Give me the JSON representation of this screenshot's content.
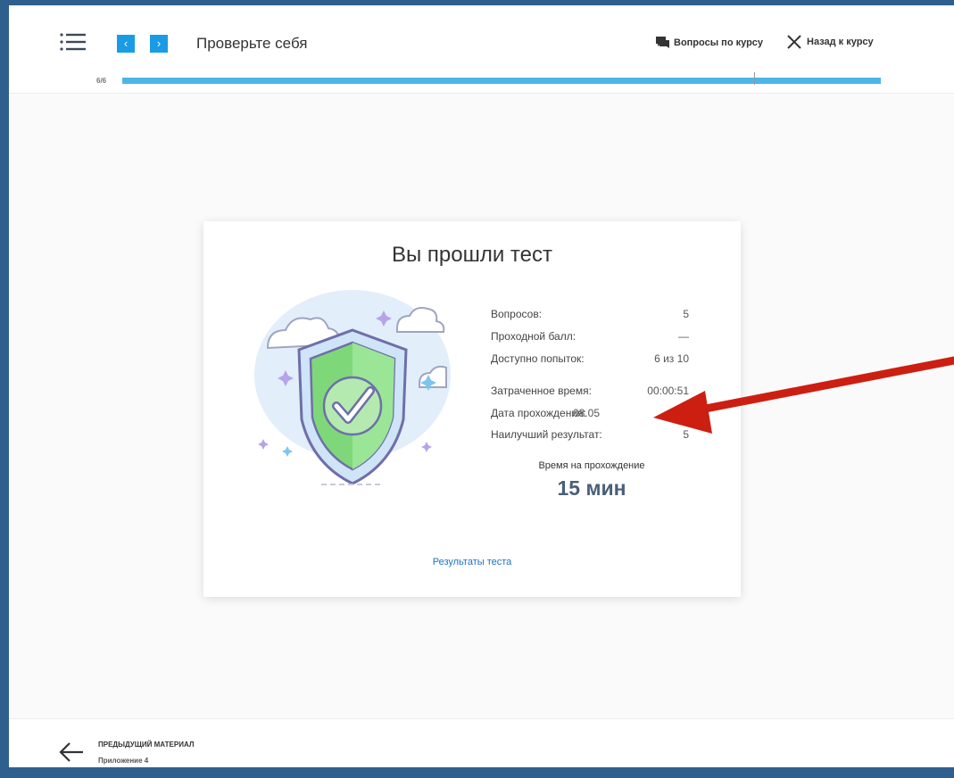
{
  "header": {
    "title": "Проверьте себя",
    "course_questions": "Вопросы по курсу",
    "back_to_course": "Назад к курсу",
    "progress_text": "6/6",
    "progress_fraction": 1.0
  },
  "result": {
    "heading": "Вы прошли тест",
    "stats": [
      {
        "label": "Вопросов:",
        "value": "5"
      },
      {
        "label": "Проходной балл:",
        "value": "—"
      },
      {
        "label": "Доступно попыток:",
        "value": "6 из 10"
      },
      {
        "label": "Затраченное время:",
        "value": "00:00:51"
      },
      {
        "label": "Дата прохождения:",
        "value": "08.05"
      },
      {
        "label": "Наилучший результат:",
        "value": "5"
      }
    ],
    "time_label": "Время на прохождение",
    "time_value": "15 мин",
    "results_link": "Результаты теста"
  },
  "footer": {
    "prev_label": "ПРЕДЫДУЩИЙ МАТЕРИАЛ",
    "prev_title": "Приложение 4"
  },
  "icons": {
    "menu": "menu-list-icon",
    "prev": "chevron-left-icon",
    "next": "chevron-right-icon",
    "chat": "chat-icon",
    "close": "close-icon",
    "shield": "shield-check-icon",
    "back_arrow": "arrow-left-icon"
  },
  "colors": {
    "accent": "#1a9be6",
    "progress": "#4cb6e6",
    "shield_green": "#7ed87a",
    "annotation_arrow": "#cc1f12",
    "frame": "#2e5f8e"
  }
}
